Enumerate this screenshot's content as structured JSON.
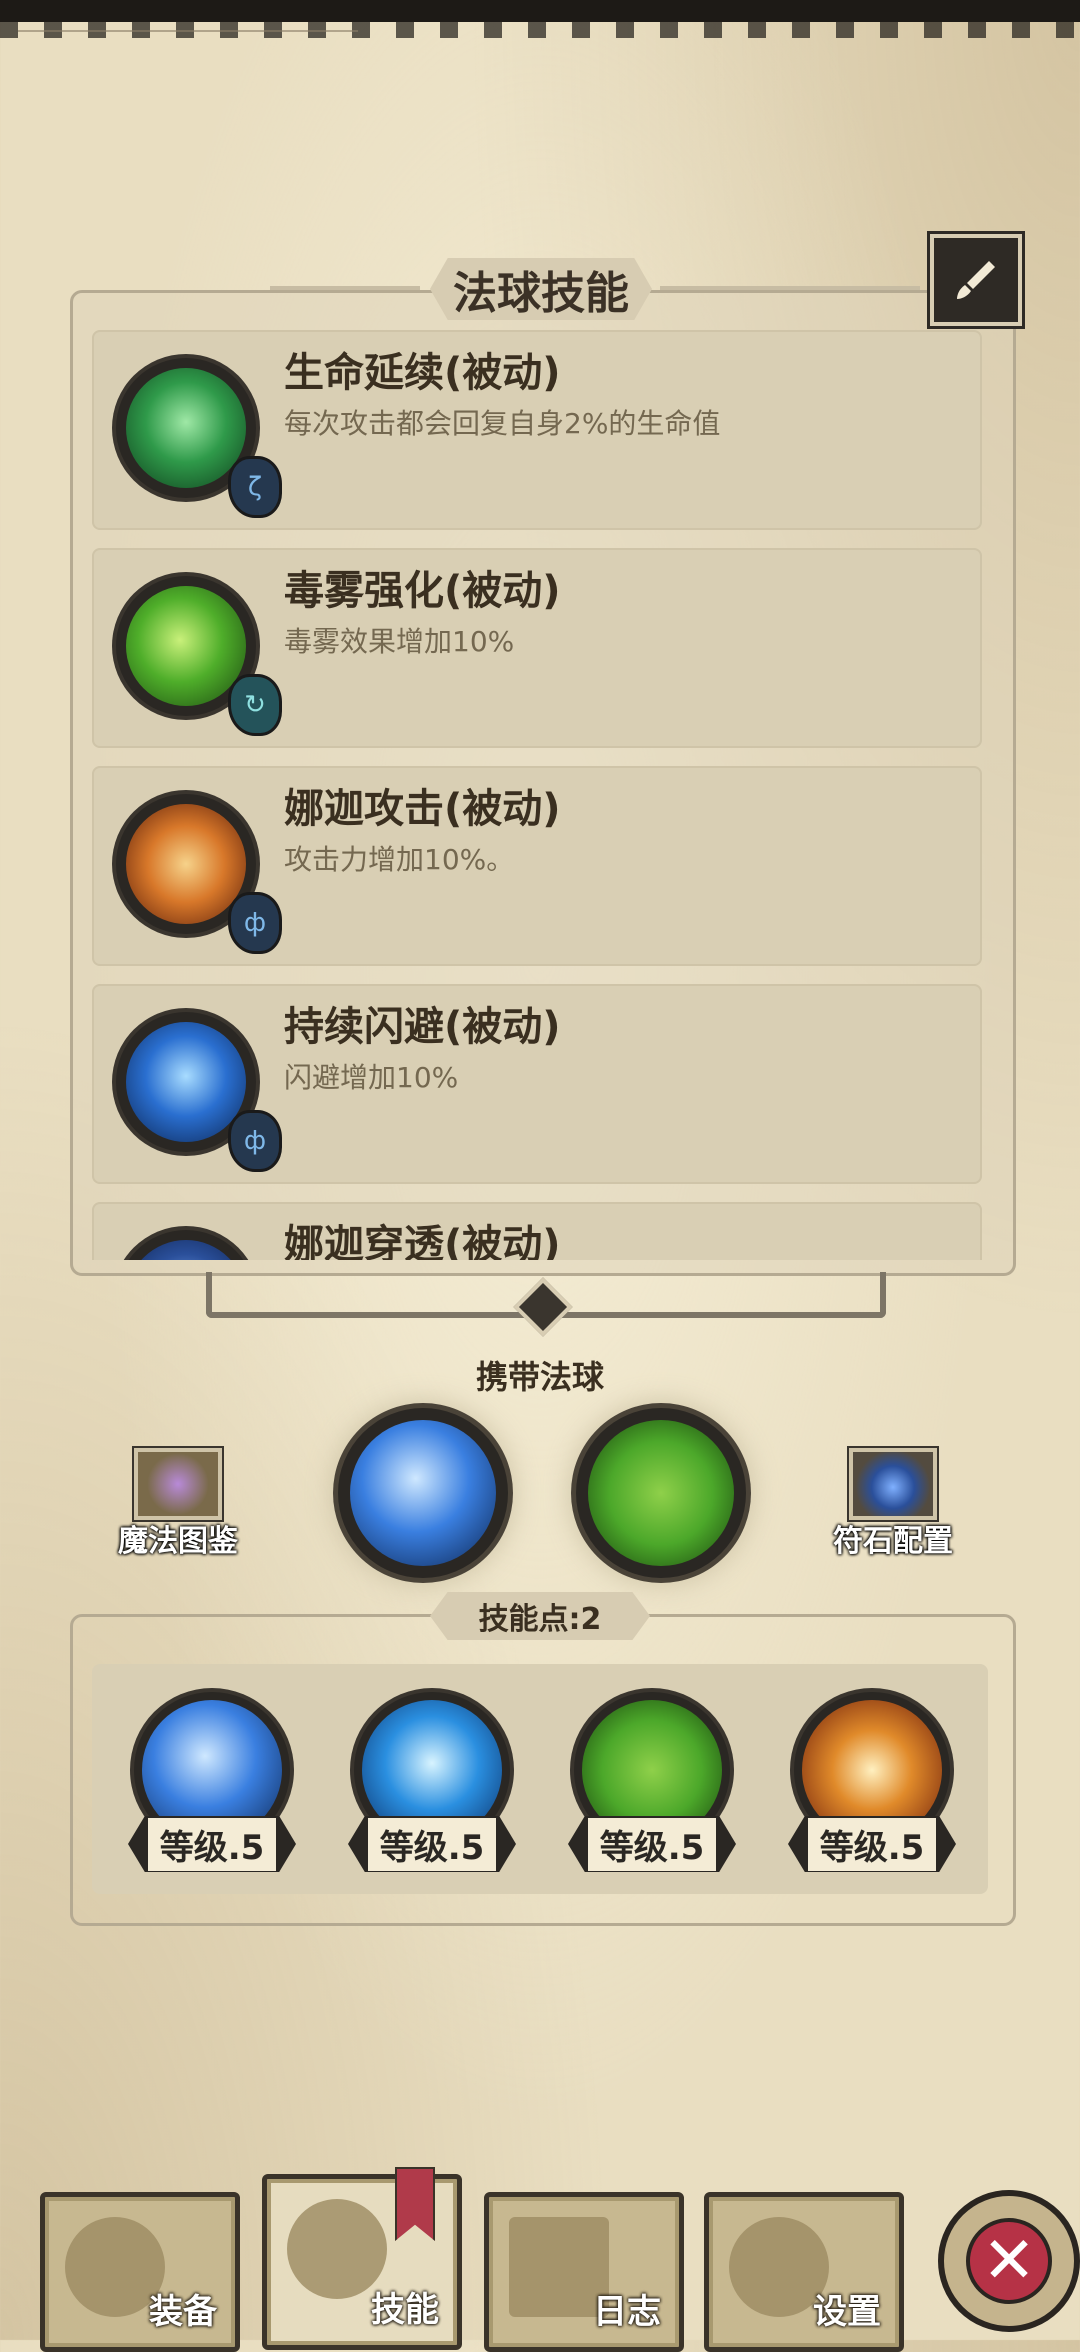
{
  "panel_title": "法球技能",
  "skills": [
    {
      "name": "生命延续(被动)",
      "desc": "每次攻击都会回复自身2%的生命值",
      "icon": "healing-hands-icon",
      "rune": "ζ",
      "color": "#2f9a4a"
    },
    {
      "name": "毒雾强化(被动)",
      "desc": "毒雾效果增加10%",
      "icon": "poison-mist-icon",
      "rune": "↻",
      "color": "#4fae2a"
    },
    {
      "name": "娜迦攻击(被动)",
      "desc": "攻击力增加10%。",
      "icon": "fist-icon",
      "rune": "ф",
      "color": "#d8782a"
    },
    {
      "name": "持续闪避(被动)",
      "desc": "闪避增加10%",
      "icon": "dodge-figure-icon",
      "rune": "ф",
      "color": "#2a6fd0"
    },
    {
      "name": "娜迦穿透(被动)",
      "desc": "",
      "icon": "pierce-icon",
      "rune": "",
      "color": "#2a4f9a"
    }
  ],
  "carry": {
    "label": "携带法球",
    "left_button": "魔法图鉴",
    "right_button": "符石配置",
    "orbs": [
      {
        "icon": "ice-crystal-orb-icon",
        "color": "#3a7fe0"
      },
      {
        "icon": "poison-orb-icon",
        "color": "#4ca82a"
      }
    ]
  },
  "skill_points": {
    "label": "技能点:2",
    "orbs": [
      {
        "icon": "ice-crystal-orb-icon",
        "level": "等级.5",
        "color": "#3a7fe0"
      },
      {
        "icon": "lightning-orb-icon",
        "level": "等级.5",
        "color": "#2a8fe0"
      },
      {
        "icon": "poison-orb-icon",
        "level": "等级.5",
        "color": "#4ca82a"
      },
      {
        "icon": "fire-vortex-orb-icon",
        "level": "等级.5",
        "color": "#e08a2a"
      }
    ]
  },
  "nav": {
    "equip": "装备",
    "skills": "技能",
    "log": "日志",
    "settings": "设置",
    "active": "技能"
  }
}
